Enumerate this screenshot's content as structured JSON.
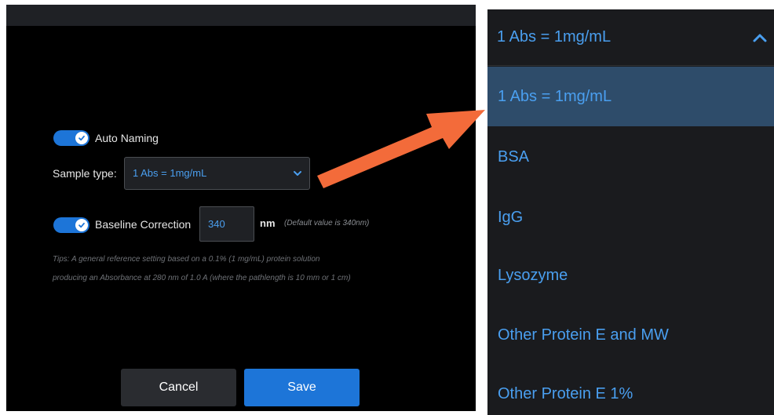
{
  "dialog": {
    "auto_naming_label": "Auto Naming",
    "auto_naming_on": true,
    "sample_type_label": "Sample type:",
    "sample_type_value": "1 Abs = 1mg/mL",
    "baseline_label": "Baseline Correction",
    "baseline_on": true,
    "baseline_value": "340",
    "baseline_unit": "nm",
    "baseline_hint": "(Default value is 340nm)",
    "tips_line1": "Tips: A general reference setting based on a 0.1% (1 mg/mL) protein solution",
    "tips_line2": "producing an Absorbance at 280 nm of 1.0 A (where the pathlength is 10 mm or 1 cm)",
    "cancel_label": "Cancel",
    "save_label": "Save"
  },
  "dropdown": {
    "current": "1 Abs = 1mg/mL",
    "options": [
      "1 Abs = 1mg/mL",
      "BSA",
      "IgG",
      "Lysozyme",
      "Other Protein E and MW",
      "Other Protein E 1%"
    ],
    "selected_index": 0
  },
  "colors": {
    "accent": "#1d75d8",
    "text_blue": "#4a9ff0",
    "selected_bg": "#2e4c6a",
    "arrow": "#f36b3a"
  }
}
